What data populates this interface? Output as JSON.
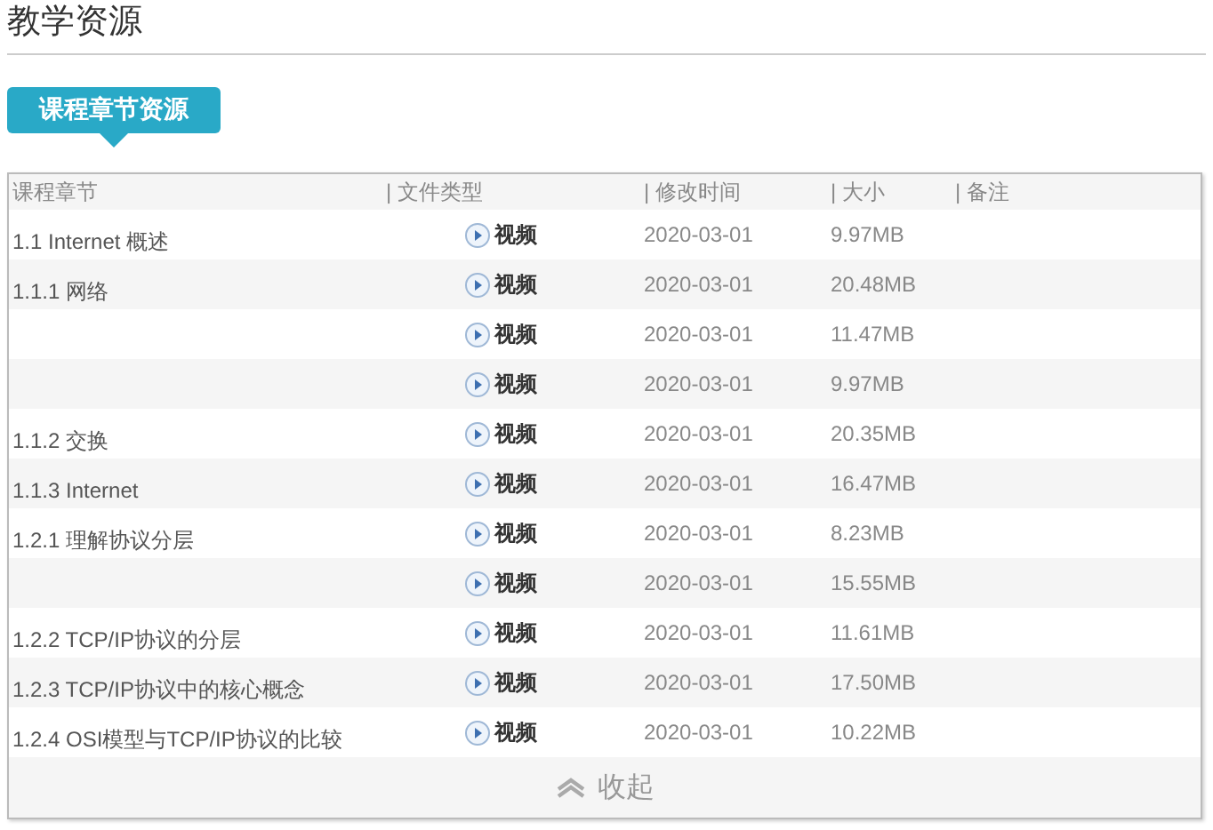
{
  "page_title": "教学资源",
  "tab": {
    "label": "课程章节资源"
  },
  "table": {
    "columns": [
      "课程章节",
      "| 文件类型",
      "| 修改时间",
      "| 大小",
      "| 备注"
    ],
    "rows": [
      {
        "chapter": "1.1 Internet 概述",
        "type": "视频",
        "modified": "2020-03-01",
        "size": "9.97MB"
      },
      {
        "chapter": "1.1.1 网络",
        "type": "视频",
        "modified": "2020-03-01",
        "size": "20.48MB"
      },
      {
        "chapter": "",
        "type": "视频",
        "modified": "2020-03-01",
        "size": "11.47MB"
      },
      {
        "chapter": "",
        "type": "视频",
        "modified": "2020-03-01",
        "size": "9.97MB"
      },
      {
        "chapter": "1.1.2 交换",
        "type": "视频",
        "modified": "2020-03-01",
        "size": "20.35MB"
      },
      {
        "chapter": "1.1.3 Internet",
        "type": "视频",
        "modified": "2020-03-01",
        "size": "16.47MB"
      },
      {
        "chapter": "1.2.1 理解协议分层",
        "type": "视频",
        "modified": "2020-03-01",
        "size": "8.23MB"
      },
      {
        "chapter": "",
        "type": "视频",
        "modified": "2020-03-01",
        "size": "15.55MB"
      },
      {
        "chapter": "1.2.2 TCP/IP协议的分层",
        "type": "视频",
        "modified": "2020-03-01",
        "size": "11.61MB"
      },
      {
        "chapter": "1.2.3 TCP/IP协议中的核心概念",
        "type": "视频",
        "modified": "2020-03-01",
        "size": "17.50MB"
      },
      {
        "chapter": "1.2.4 OSI模型与TCP/IP协议的比较",
        "type": "视频",
        "modified": "2020-03-01",
        "size": "10.22MB"
      }
    ]
  },
  "collapse": {
    "label": "收起"
  }
}
